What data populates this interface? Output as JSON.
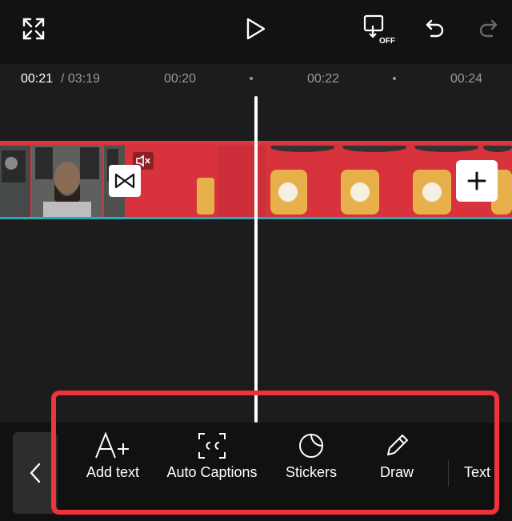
{
  "ruler": {
    "current": "00:21",
    "total": "/ 03:19",
    "marks": [
      "00:20",
      "00:22",
      "00:24"
    ]
  },
  "toolbar": {
    "items": [
      {
        "label": "Add text",
        "icon": "add-text-icon"
      },
      {
        "label": "Auto Captions",
        "icon": "captions-icon"
      },
      {
        "label": "Stickers",
        "icon": "sticker-icon"
      },
      {
        "label": "Draw",
        "icon": "pencil-icon"
      },
      {
        "label": "Text",
        "icon": "text-template-icon"
      }
    ]
  },
  "colors": {
    "accent": "#f0323c",
    "track_top": "#e03a47",
    "track_bottom": "#2aa9b8",
    "clip_red": "#d8323c"
  }
}
